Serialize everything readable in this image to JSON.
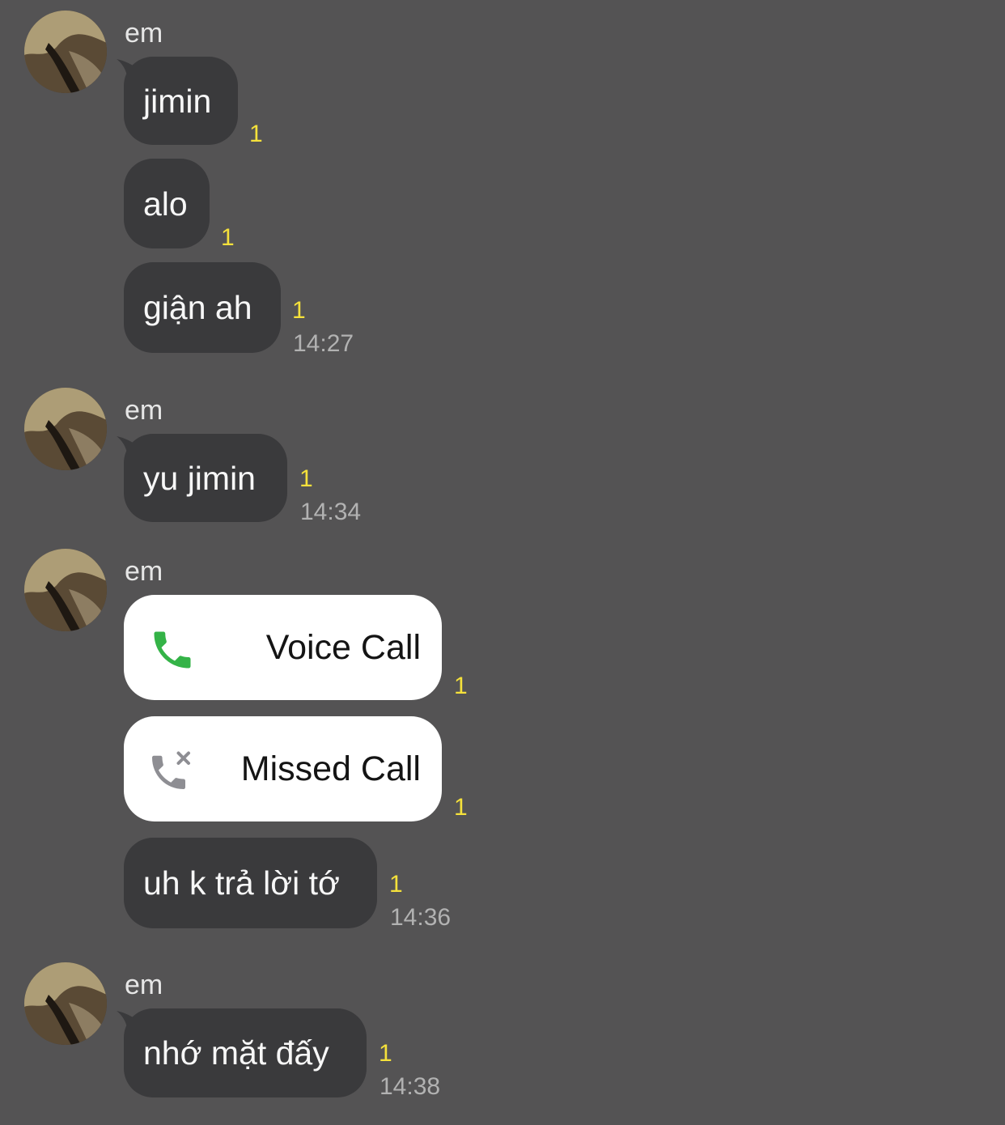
{
  "groups": [
    {
      "sender": "em",
      "messages": [
        {
          "text": "jimin",
          "unread": "1"
        },
        {
          "text": "alo",
          "unread": "1"
        },
        {
          "text": "giận ah",
          "unread": "1",
          "time": "14:27"
        }
      ]
    },
    {
      "sender": "em",
      "messages": [
        {
          "text": "yu jimin",
          "unread": "1",
          "time": "14:34"
        }
      ]
    },
    {
      "sender": "em",
      "messages": [
        {
          "call_label": "Voice Call",
          "icon": "phone-icon",
          "unread": "1"
        },
        {
          "call_label": "Missed Call",
          "icon": "missed-call-icon",
          "unread": "1"
        },
        {
          "text": "uh k trả lời tớ",
          "unread": "1",
          "time": "14:36"
        }
      ]
    },
    {
      "sender": "em",
      "messages": [
        {
          "text": "nhớ mặt đấy",
          "unread": "1",
          "time": "14:38"
        }
      ]
    }
  ],
  "colors": {
    "background": "#545354",
    "bubble": "#3a3a3c",
    "call_card": "#ffffff",
    "unread": "#f5e13b",
    "voice_icon": "#34b347",
    "missed_icon": "#8e8e93"
  }
}
